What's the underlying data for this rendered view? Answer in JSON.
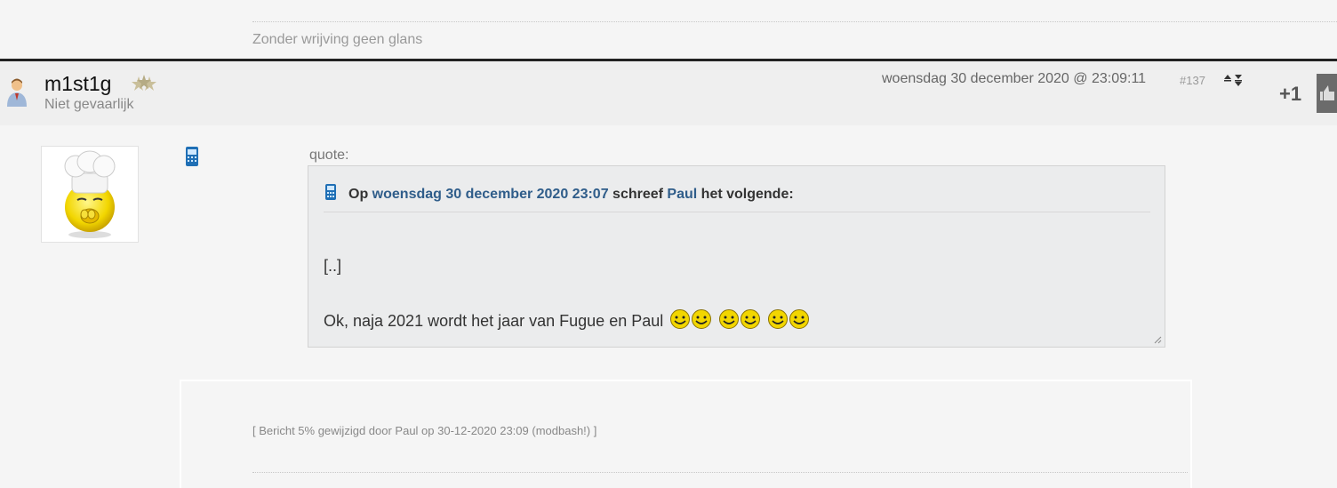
{
  "previous_post": {
    "signature": "Zonder wrijving geen glans"
  },
  "post": {
    "username": "m1st1g",
    "user_title": "Niet gevaarlijk",
    "date": "woensdag 30 december 2020 @ 23:09:11",
    "number": "#137",
    "score": "+1",
    "quote": {
      "label": "quote:",
      "header_op": "Op",
      "header_date": "woensdag 30 december 2020 23:07",
      "header_schreef": "schreef",
      "header_author": "Paul",
      "header_tail": "het volgende:",
      "ellipsis": "[..]",
      "text": "Ok, naja 2021 wordt het jaar van Fugue en Paul"
    },
    "edit_note": "[ Bericht 5% gewijzigd door Paul op 30-12-2020 23:09 (modbash!) ]"
  },
  "icons": {
    "small_avatar": "user-icon",
    "stars": "rank-stars-icon",
    "nav": "up-down-arrows-icon",
    "like": "thumbs-up-icon",
    "phone": "mobile-phone-icon",
    "smiley": "smiley-icon"
  },
  "colors": {
    "link": "#2f5d8a",
    "smiley_yellow": "#f2d600"
  }
}
